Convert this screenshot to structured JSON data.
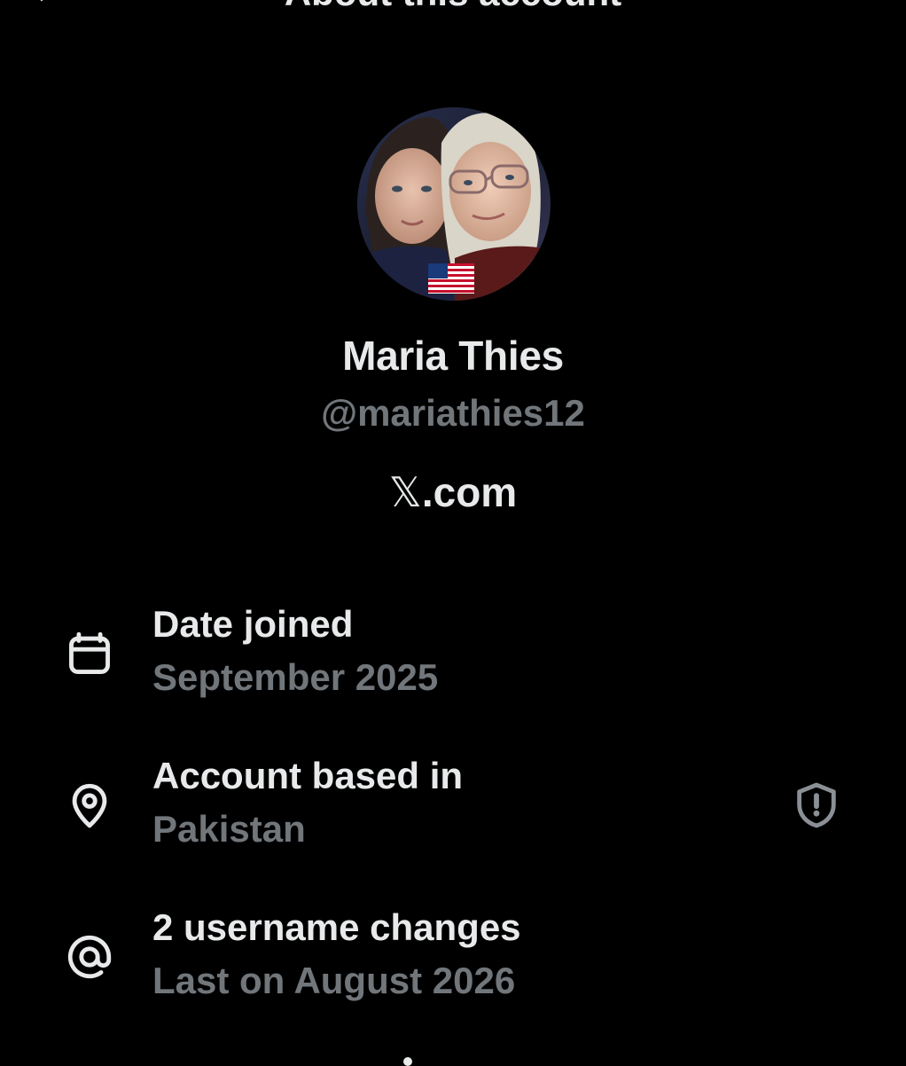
{
  "header": {
    "title": "About this account",
    "back_icon": "back-arrow-icon"
  },
  "profile": {
    "avatar_alt": "Profile picture",
    "display_name": "Maria Thies",
    "handle": "@mariathies12",
    "x_glyph": "𝕏",
    "x_suffix": ".com"
  },
  "details": {
    "date_joined": {
      "icon": "calendar-icon",
      "label": "Date joined",
      "value": "September 2025"
    },
    "account_based": {
      "icon": "location-pin-icon",
      "label": "Account based in",
      "value": "Pakistan",
      "badge_icon": "shield-alert-icon"
    },
    "username_changes": {
      "icon": "at-sign-icon",
      "label": "2 username changes",
      "value": "Last on August 2026"
    }
  },
  "colors": {
    "background": "#000000",
    "primary_text": "#e7e9ea",
    "secondary_text": "#71767b"
  }
}
